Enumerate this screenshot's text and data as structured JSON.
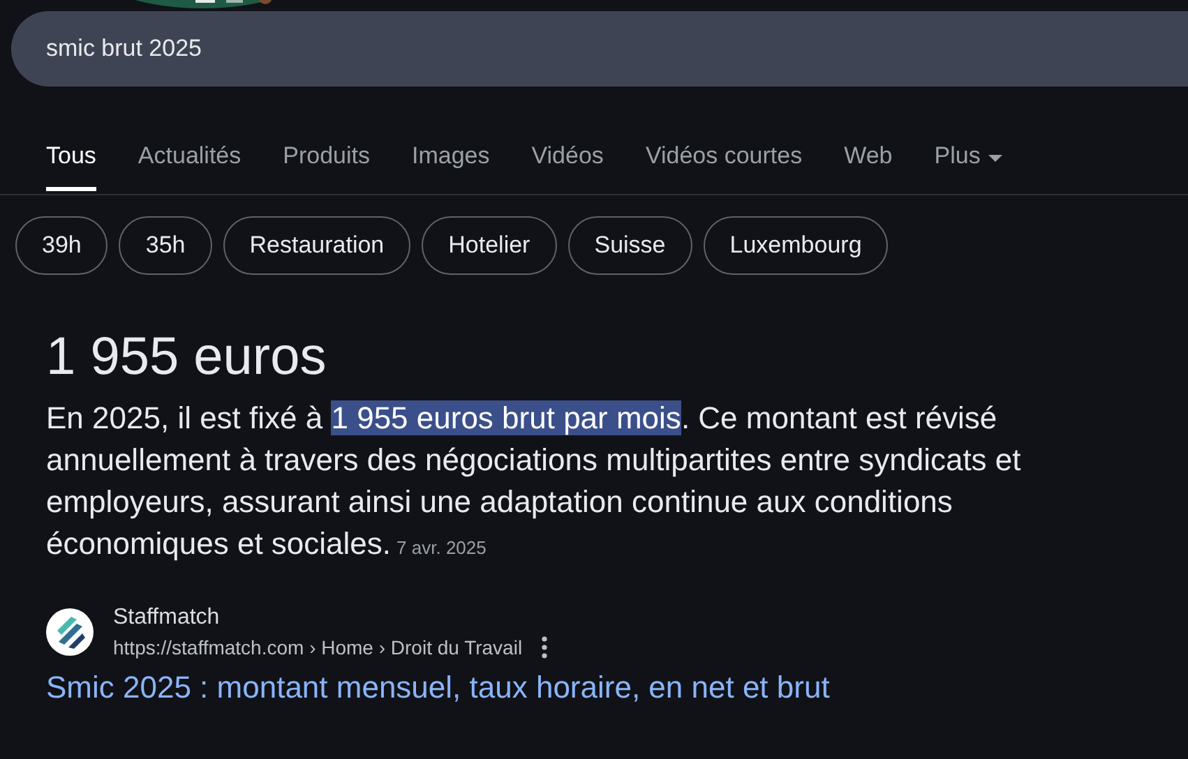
{
  "search": {
    "value": "smic brut 2025"
  },
  "tabs": [
    {
      "label": "Tous",
      "selected": true
    },
    {
      "label": "Actualités",
      "selected": false
    },
    {
      "label": "Produits",
      "selected": false
    },
    {
      "label": "Images",
      "selected": false
    },
    {
      "label": "Vidéos",
      "selected": false
    },
    {
      "label": "Vidéos courtes",
      "selected": false
    },
    {
      "label": "Web",
      "selected": false
    },
    {
      "label": "Plus",
      "selected": false,
      "kind": "menu"
    }
  ],
  "chips": [
    "39h",
    "35h",
    "Restauration",
    "Hotelier",
    "Suisse",
    "Luxembourg"
  ],
  "answer": {
    "heading": "1 955 euros",
    "segments": [
      {
        "text": "En 2025, il est fixé à ",
        "highlighted": false
      },
      {
        "text": "1 955 euros brut par mois",
        "highlighted": true
      },
      {
        "text": ". Ce montant est révisé annuellement à travers des négociations multipartites entre syndicats et employeurs, assurant ainsi une adaptation continue aux conditions économiques et sociales.",
        "highlighted": false
      }
    ],
    "date": "7 avr. 2025"
  },
  "source": {
    "name": "Staffmatch",
    "url": "https://staffmatch.com › Home › Droit du Travail",
    "title": "Smic 2025 : montant mensuel, taux horaire, en net et brut"
  }
}
